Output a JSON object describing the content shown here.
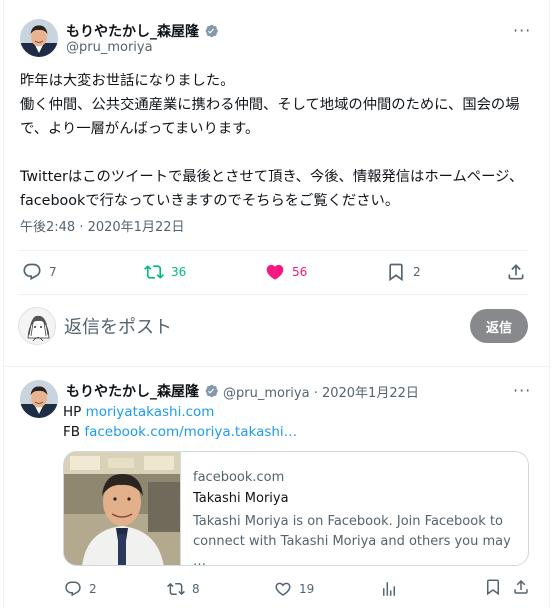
{
  "main_tweet": {
    "name": "もりやたかし_森屋隆",
    "handle": "@pru_moriya",
    "body_lines": [
      "昨年は大変お世話になりました。",
      "働く仲間、公共交通産業に携わる仲間、そして地域の仲間のために、国会の場で、より一層がんばってまいります。",
      "",
      "Twitterはこのツイートで最後とさせて頂き、今後、情報発信はホームページ、facebookで行なっていきますのでそちらをご覧ください。"
    ],
    "timestamp": "午後2:48 · 2020年1月22日",
    "stats": {
      "replies": "7",
      "retweets": "36",
      "likes": "56",
      "bookmarks": "2"
    },
    "retweet_color": "#00ba7c",
    "like_color": "#f91880"
  },
  "reply_box": {
    "placeholder": "返信をポスト",
    "button_label": "返信"
  },
  "second_tweet": {
    "name": "もりやたかし_森屋隆",
    "handle_date": "@pru_moriya · 2020年1月22日",
    "hp_label": "HP",
    "hp_link": "moriyatakashi.com",
    "fb_label": "FB",
    "fb_link": "facebook.com/moriya.takashi…",
    "card": {
      "domain": "facebook.com",
      "title": "Takashi Moriya",
      "description": "Takashi Moriya is on Facebook. Join Facebook to connect with Takashi Moriya and others you may …"
    },
    "stats": {
      "replies": "2",
      "retweets": "8",
      "likes": "19"
    }
  },
  "icons": {
    "more": "more-dots-icon",
    "verified": "verified-badge-icon",
    "reply": "reply-icon",
    "retweet": "retweet-icon",
    "like": "heart-icon",
    "bookmark": "bookmark-icon",
    "share": "share-icon",
    "views": "views-chart-icon"
  },
  "colors": {
    "link": "#1d9bf0",
    "verified": "#829aab",
    "text_secondary": "#536471"
  }
}
